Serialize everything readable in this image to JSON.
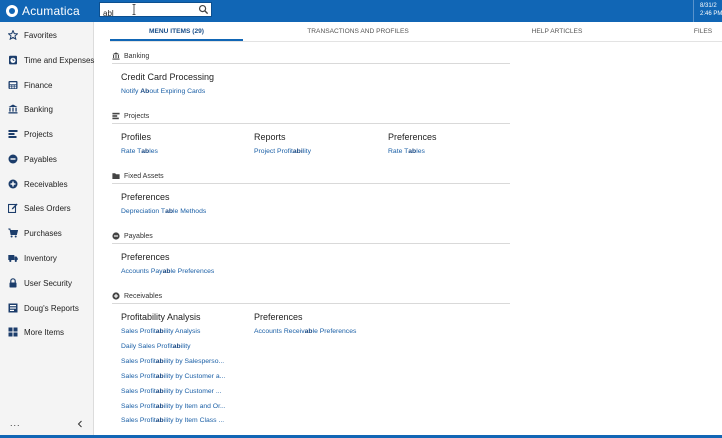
{
  "brand": {
    "name": "Acumatica"
  },
  "search": {
    "value": "abl"
  },
  "clock": {
    "date": "8/31/2",
    "time": "2:46 PM"
  },
  "sidebar": {
    "items": [
      {
        "label": "Favorites",
        "icon": "star-icon"
      },
      {
        "label": "Time and Expenses",
        "icon": "clock-icon"
      },
      {
        "label": "Finance",
        "icon": "finance-icon"
      },
      {
        "label": "Banking",
        "icon": "bank-icon"
      },
      {
        "label": "Projects",
        "icon": "projects-icon"
      },
      {
        "label": "Payables",
        "icon": "minus-circle-icon"
      },
      {
        "label": "Receivables",
        "icon": "plus-circle-icon"
      },
      {
        "label": "Sales Orders",
        "icon": "edit-icon"
      },
      {
        "label": "Purchases",
        "icon": "cart-icon"
      },
      {
        "label": "Inventory",
        "icon": "truck-icon"
      },
      {
        "label": "User Security",
        "icon": "lock-icon"
      },
      {
        "label": "Doug's Reports",
        "icon": "report-icon"
      },
      {
        "label": "More Items",
        "icon": "grid-icon"
      }
    ],
    "more": "...",
    "collapse_icon": "chevron-left-icon"
  },
  "tabs": [
    {
      "label": "MENU ITEMS  (29)",
      "active": true
    },
    {
      "label": "TRANSACTIONS AND PROFILES"
    },
    {
      "label": "HELP ARTICLES"
    },
    {
      "label": "FILES"
    }
  ],
  "results": {
    "banking": {
      "header": "Banking",
      "groups": [
        {
          "title": "Credit Card Processing",
          "links": [
            [
              "Notify ",
              "Ab",
              "out Expiring Cards"
            ]
          ]
        }
      ]
    },
    "projects": {
      "header": "Projects",
      "groups": [
        {
          "title": "Profiles",
          "links": [
            [
              "Rate T",
              "ab",
              "les"
            ]
          ]
        },
        {
          "title": "Reports",
          "links": [
            [
              "Project Profit",
              "abi",
              "lity"
            ]
          ]
        },
        {
          "title": "Preferences",
          "links": [
            [
              "Rate T",
              "ab",
              "les"
            ]
          ]
        }
      ]
    },
    "fixed_assets": {
      "header": "Fixed Assets",
      "groups": [
        {
          "title": "Preferences",
          "links": [
            [
              "Depreciation T",
              "ab",
              "le Methods"
            ]
          ]
        }
      ]
    },
    "payables": {
      "header": "Payables",
      "groups": [
        {
          "title": "Preferences",
          "links": [
            [
              "Accounts Pay",
              "ab",
              "le Preferences"
            ]
          ]
        }
      ]
    },
    "receivables": {
      "header": "Receivables",
      "groups": [
        {
          "title": "Profitability Analysis",
          "links": [
            [
              "Sales Profit",
              "ab",
              "ility Analysis"
            ],
            [
              "Daily Sales Profit",
              "ab",
              "ility"
            ],
            [
              "Sales Profit",
              "ab",
              "ility by Salesperso..."
            ],
            [
              "Sales Profit",
              "ab",
              "ility by Customer a..."
            ],
            [
              "Sales Profit",
              "ab",
              "ility by Customer ..."
            ],
            [
              "Sales Profit",
              "ab",
              "ility by Item and Or..."
            ],
            [
              "Sales Profit",
              "ab",
              "ility by Item Class ..."
            ]
          ]
        },
        {
          "title": "Preferences",
          "links": [
            [
              "Accounts Receiv",
              "ab",
              "le Preferences"
            ]
          ]
        }
      ]
    }
  }
}
